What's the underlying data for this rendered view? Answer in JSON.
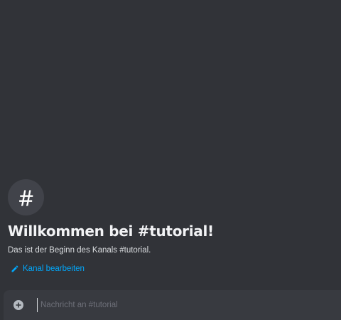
{
  "colors": {
    "background": "#313338",
    "composer_background": "#383a40",
    "avatar_background": "#41434a",
    "title": "#f2f3f5",
    "text": "#dbdee1",
    "link": "#00a8fc",
    "icon": "#b5bac1",
    "placeholder": "#6d6f78"
  },
  "welcome": {
    "channel_icon": "hashtag-icon",
    "title": "Willkommen bei #tutorial!",
    "description": "Das ist der Beginn des Kanals #tutorial.",
    "edit_icon": "pencil-icon",
    "edit_label": "Kanal bearbeiten"
  },
  "composer": {
    "attach_icon": "plus-circle-icon",
    "placeholder": "Nachricht an #tutorial",
    "value": ""
  }
}
